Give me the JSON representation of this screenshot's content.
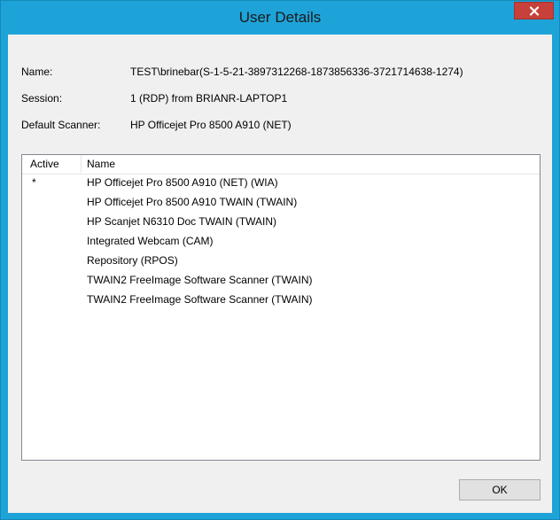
{
  "window": {
    "title": "User Details",
    "close_label": "x",
    "frame_color": "#1ea3d8",
    "close_color": "#c7403a"
  },
  "details": {
    "name_label": "Name:",
    "name_value": "TEST\\brinebar(S-1-5-21-3897312268-1873856336-3721714638-1274)",
    "session_label": "Session:",
    "session_value": "1 (RDP) from BRIANR-LAPTOP1",
    "scanner_label": "Default Scanner:",
    "scanner_value": "HP Officejet Pro 8500 A910 (NET)"
  },
  "scanner_list": {
    "columns": [
      "Active",
      "Name"
    ],
    "rows": [
      {
        "active": "*",
        "name": "HP Officejet Pro 8500 A910 (NET) (WIA)"
      },
      {
        "active": "",
        "name": "HP Officejet Pro 8500 A910 TWAIN (TWAIN)"
      },
      {
        "active": "",
        "name": "HP Scanjet N6310 Doc TWAIN (TWAIN)"
      },
      {
        "active": "",
        "name": "Integrated Webcam (CAM)"
      },
      {
        "active": "",
        "name": "Repository (RPOS)"
      },
      {
        "active": "",
        "name": "TWAIN2 FreeImage Software Scanner (TWAIN)"
      },
      {
        "active": "",
        "name": "TWAIN2 FreeImage Software Scanner (TWAIN)"
      }
    ]
  },
  "buttons": {
    "ok_label": "OK"
  }
}
